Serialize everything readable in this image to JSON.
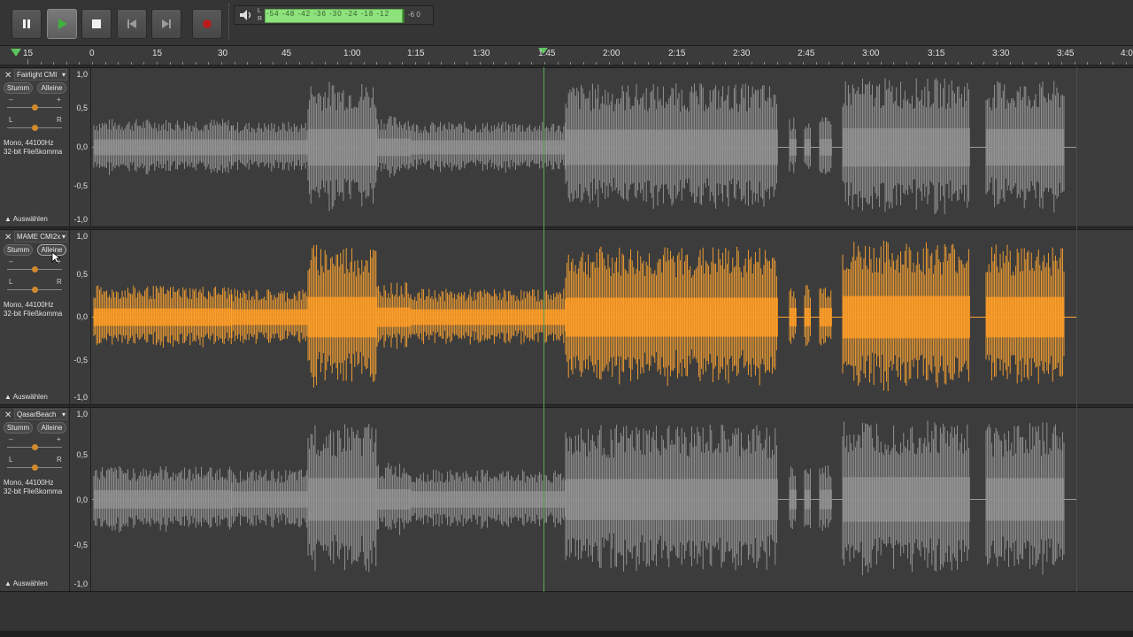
{
  "toolbar": {
    "pause_label": "Pause",
    "play_label": "Play",
    "stop_label": "Stop",
    "skip_start_label": "Skip to Start",
    "skip_end_label": "Skip to End",
    "record_label": "Record",
    "meter_left": "L",
    "meter_right": "R",
    "meter_ticks": "-54 -48 -42 -36 -30 -24 -18 -12",
    "meter_end": "-6   0"
  },
  "ruler": {
    "labels": [
      "15",
      "0",
      "15",
      "30",
      "45",
      "1:00",
      "1:15",
      "1:30",
      "1:45",
      "2:00",
      "2:15",
      "2:30",
      "2:45",
      "3:00",
      "3:15",
      "3:30",
      "3:45",
      "4:0"
    ]
  },
  "scale": {
    "top": "1,0",
    "half": "0,5",
    "zero": "0,0",
    "neg_half": "-0,5",
    "bottom": "-1,0"
  },
  "tracks": [
    {
      "name": "Fairlight CMI",
      "mute": "Stumm",
      "solo": "Alleine",
      "gain_minus": "–",
      "gain_plus": "+",
      "pan_l": "L",
      "pan_r": "R",
      "info1": "Mono, 44100Hz",
      "info2": "32-bit Fließkomma",
      "select": "Auswählen",
      "color": "#9a9a9a",
      "dark": "#7d7d7d"
    },
    {
      "name": "MAME CMI2x",
      "mute": "Stumm",
      "solo": "Alleine",
      "gain_minus": "–",
      "gain_plus": "+",
      "pan_l": "L",
      "pan_r": "R",
      "info1": "Mono, 44100Hz",
      "info2": "32-bit Fließkomma",
      "select": "Auswählen",
      "color": "#ffa531",
      "dark": "#f08c1a"
    },
    {
      "name": "QasarBeach",
      "mute": "Stumm",
      "solo": "Alleine",
      "gain_minus": "–",
      "gain_plus": "+",
      "pan_l": "L",
      "pan_r": "R",
      "info1": "Mono, 44100Hz",
      "info2": "32-bit Fließkomma",
      "select": "Auswählen",
      "color": "#9a9a9a",
      "dark": "#7d7d7d"
    }
  ],
  "colors": {
    "background": "#2b2b2b",
    "cursor": "#5aa85a",
    "meter": "#8ee27c"
  }
}
